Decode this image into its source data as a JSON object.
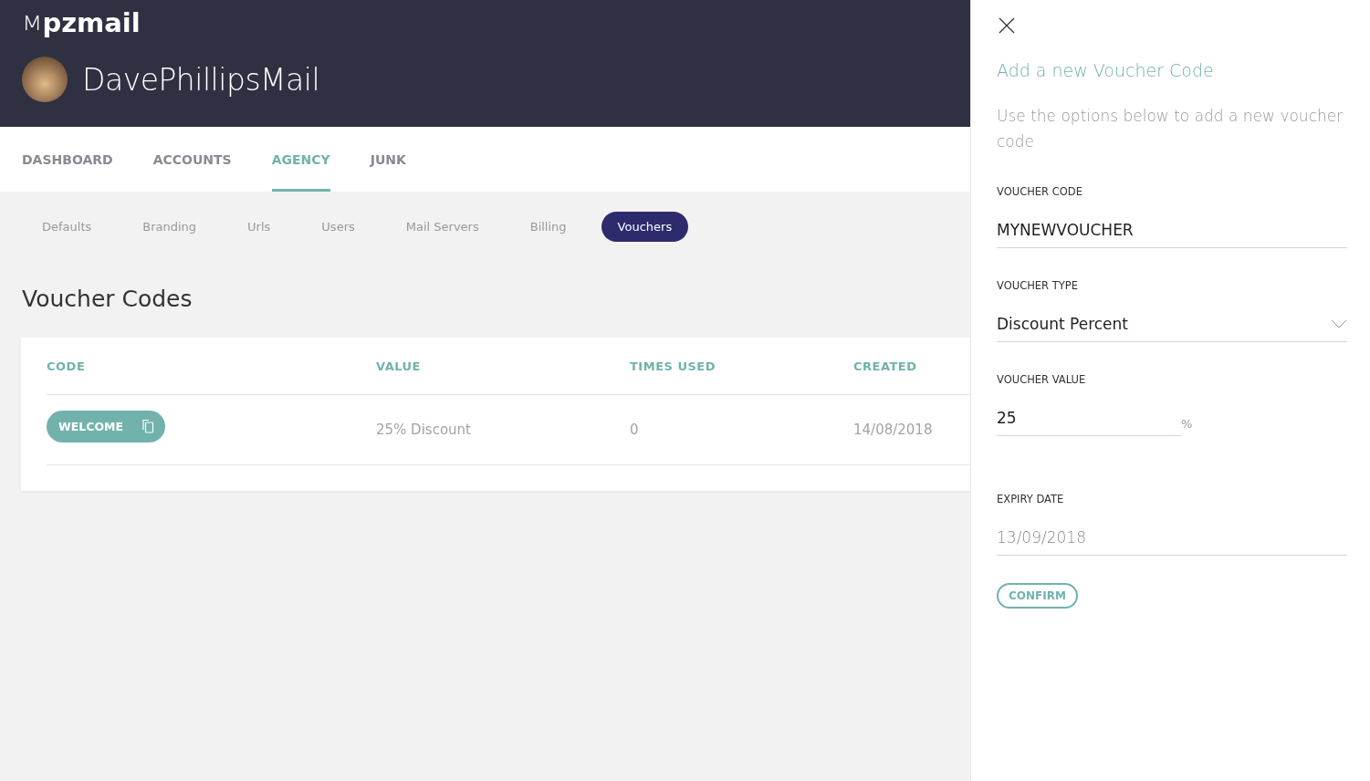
{
  "header": {
    "logo": {
      "mark": "M",
      "name": "pzmail"
    },
    "account": "DavePhillipsMail"
  },
  "main_tabs": [
    {
      "label": "DASHBOARD",
      "selected": false
    },
    {
      "label": "ACCOUNTS",
      "selected": false
    },
    {
      "label": "AGENCY",
      "selected": true
    },
    {
      "label": "JUNK",
      "selected": false
    }
  ],
  "sub_tabs": [
    {
      "label": "Defaults",
      "selected": false
    },
    {
      "label": "Branding",
      "selected": false
    },
    {
      "label": "Urls",
      "selected": false
    },
    {
      "label": "Users",
      "selected": false
    },
    {
      "label": "Mail Servers",
      "selected": false
    },
    {
      "label": "Billing",
      "selected": false
    },
    {
      "label": "Vouchers",
      "selected": true
    }
  ],
  "page_title": "Voucher Codes",
  "table": {
    "columns": [
      "CODE",
      "VALUE",
      "TIMES USED",
      "CREATED"
    ],
    "rows": [
      {
        "code": "WELCOME",
        "value": "25% Discount",
        "times_used": "0",
        "created": "14/08/2018"
      }
    ]
  },
  "drawer": {
    "title": "Add a new Voucher Code",
    "description": "Use the options below to add a new voucher code",
    "fields": [
      {
        "kind": "text",
        "label": "VOUCHER CODE",
        "value": "MYNEWVOUCHER"
      },
      {
        "kind": "select",
        "label": "VOUCHER TYPE",
        "value": "Discount Percent"
      },
      {
        "kind": "suffix",
        "label": "VOUCHER VALUE",
        "value": "25",
        "suffix": "%"
      },
      {
        "kind": "date",
        "label": "EXPIRY DATE",
        "value": "13/09/2018"
      }
    ],
    "confirm": "CONFIRM"
  }
}
